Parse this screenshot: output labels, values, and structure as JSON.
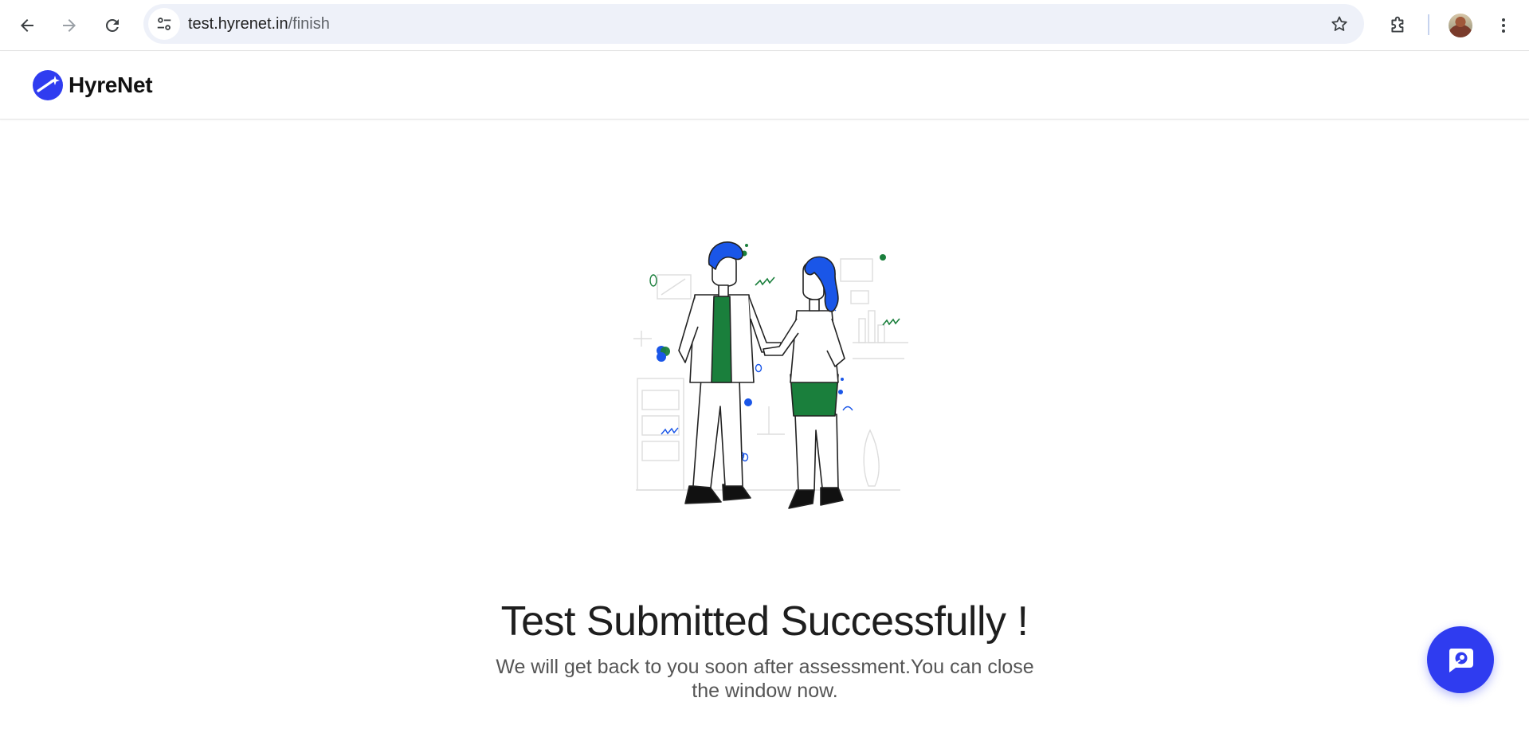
{
  "browser": {
    "url_host": "test.hyrenet.in",
    "url_path": "/finish"
  },
  "app": {
    "brand_name": "HyreNet",
    "accent_color": "#2f3cf0",
    "illustration_green": "#1a7f3c",
    "illustration_blue": "#1a56e8"
  },
  "main": {
    "title": "Test Submitted Successfully !",
    "subtitle": "We will get back to you soon after assessment.You can close the window now."
  },
  "icons": {
    "back": "arrow-left-icon",
    "forward": "arrow-right-icon",
    "reload": "reload-icon",
    "site_info": "tune-icon",
    "bookmark": "star-icon",
    "extensions": "puzzle-icon",
    "menu": "kebab-menu-icon",
    "chat": "chat-bubble-icon"
  }
}
